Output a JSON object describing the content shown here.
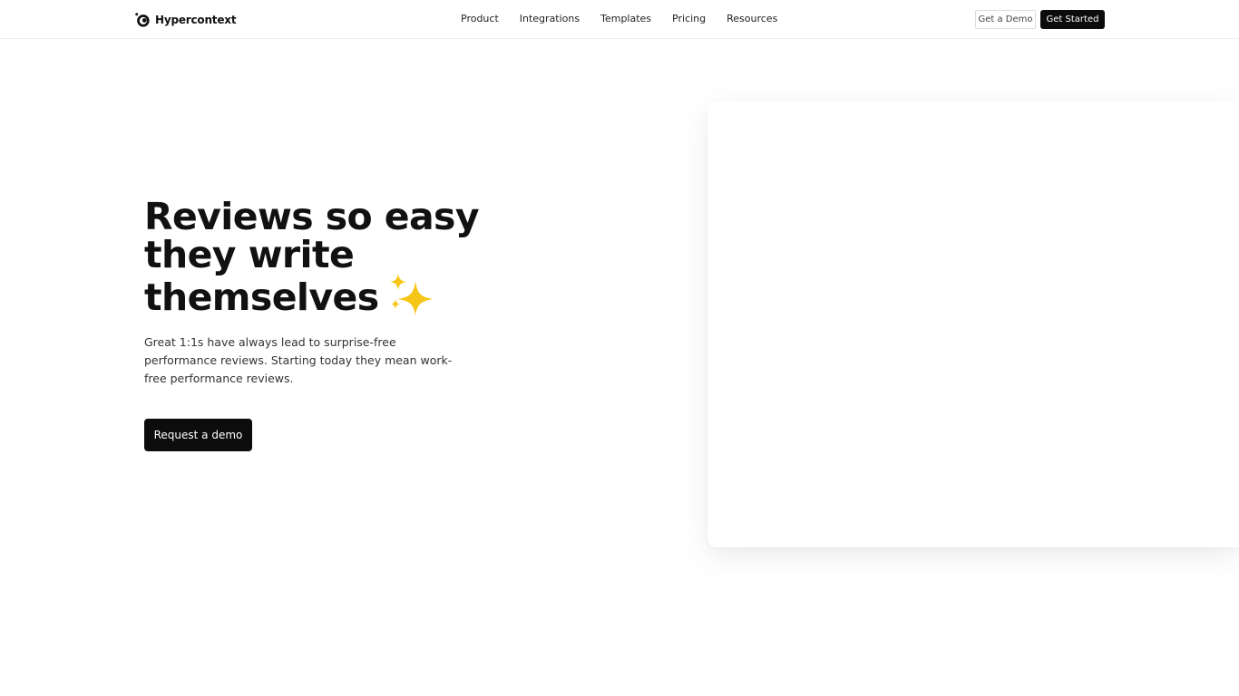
{
  "brand": {
    "name": "Hypercontext"
  },
  "nav": {
    "items": [
      {
        "label": "Product"
      },
      {
        "label": "Integrations"
      },
      {
        "label": "Templates"
      },
      {
        "label": "Pricing"
      },
      {
        "label": "Resources"
      }
    ],
    "demo_label": "Get a Demo",
    "start_label": "Get Started"
  },
  "hero": {
    "title_lines": [
      "Reviews so easy",
      "they write",
      "themselves"
    ],
    "title_emoji": "sparkles-icon",
    "description": "Great 1:1s have always lead to surprise-free performance reviews. Starting today they mean work-free performance reviews.",
    "cta_label": "Request a demo"
  },
  "colors": {
    "primary": "#0c0c0c",
    "text": "#111111",
    "muted_text": "#333333",
    "sparkle": "#f5c518",
    "background": "#ffffff"
  }
}
